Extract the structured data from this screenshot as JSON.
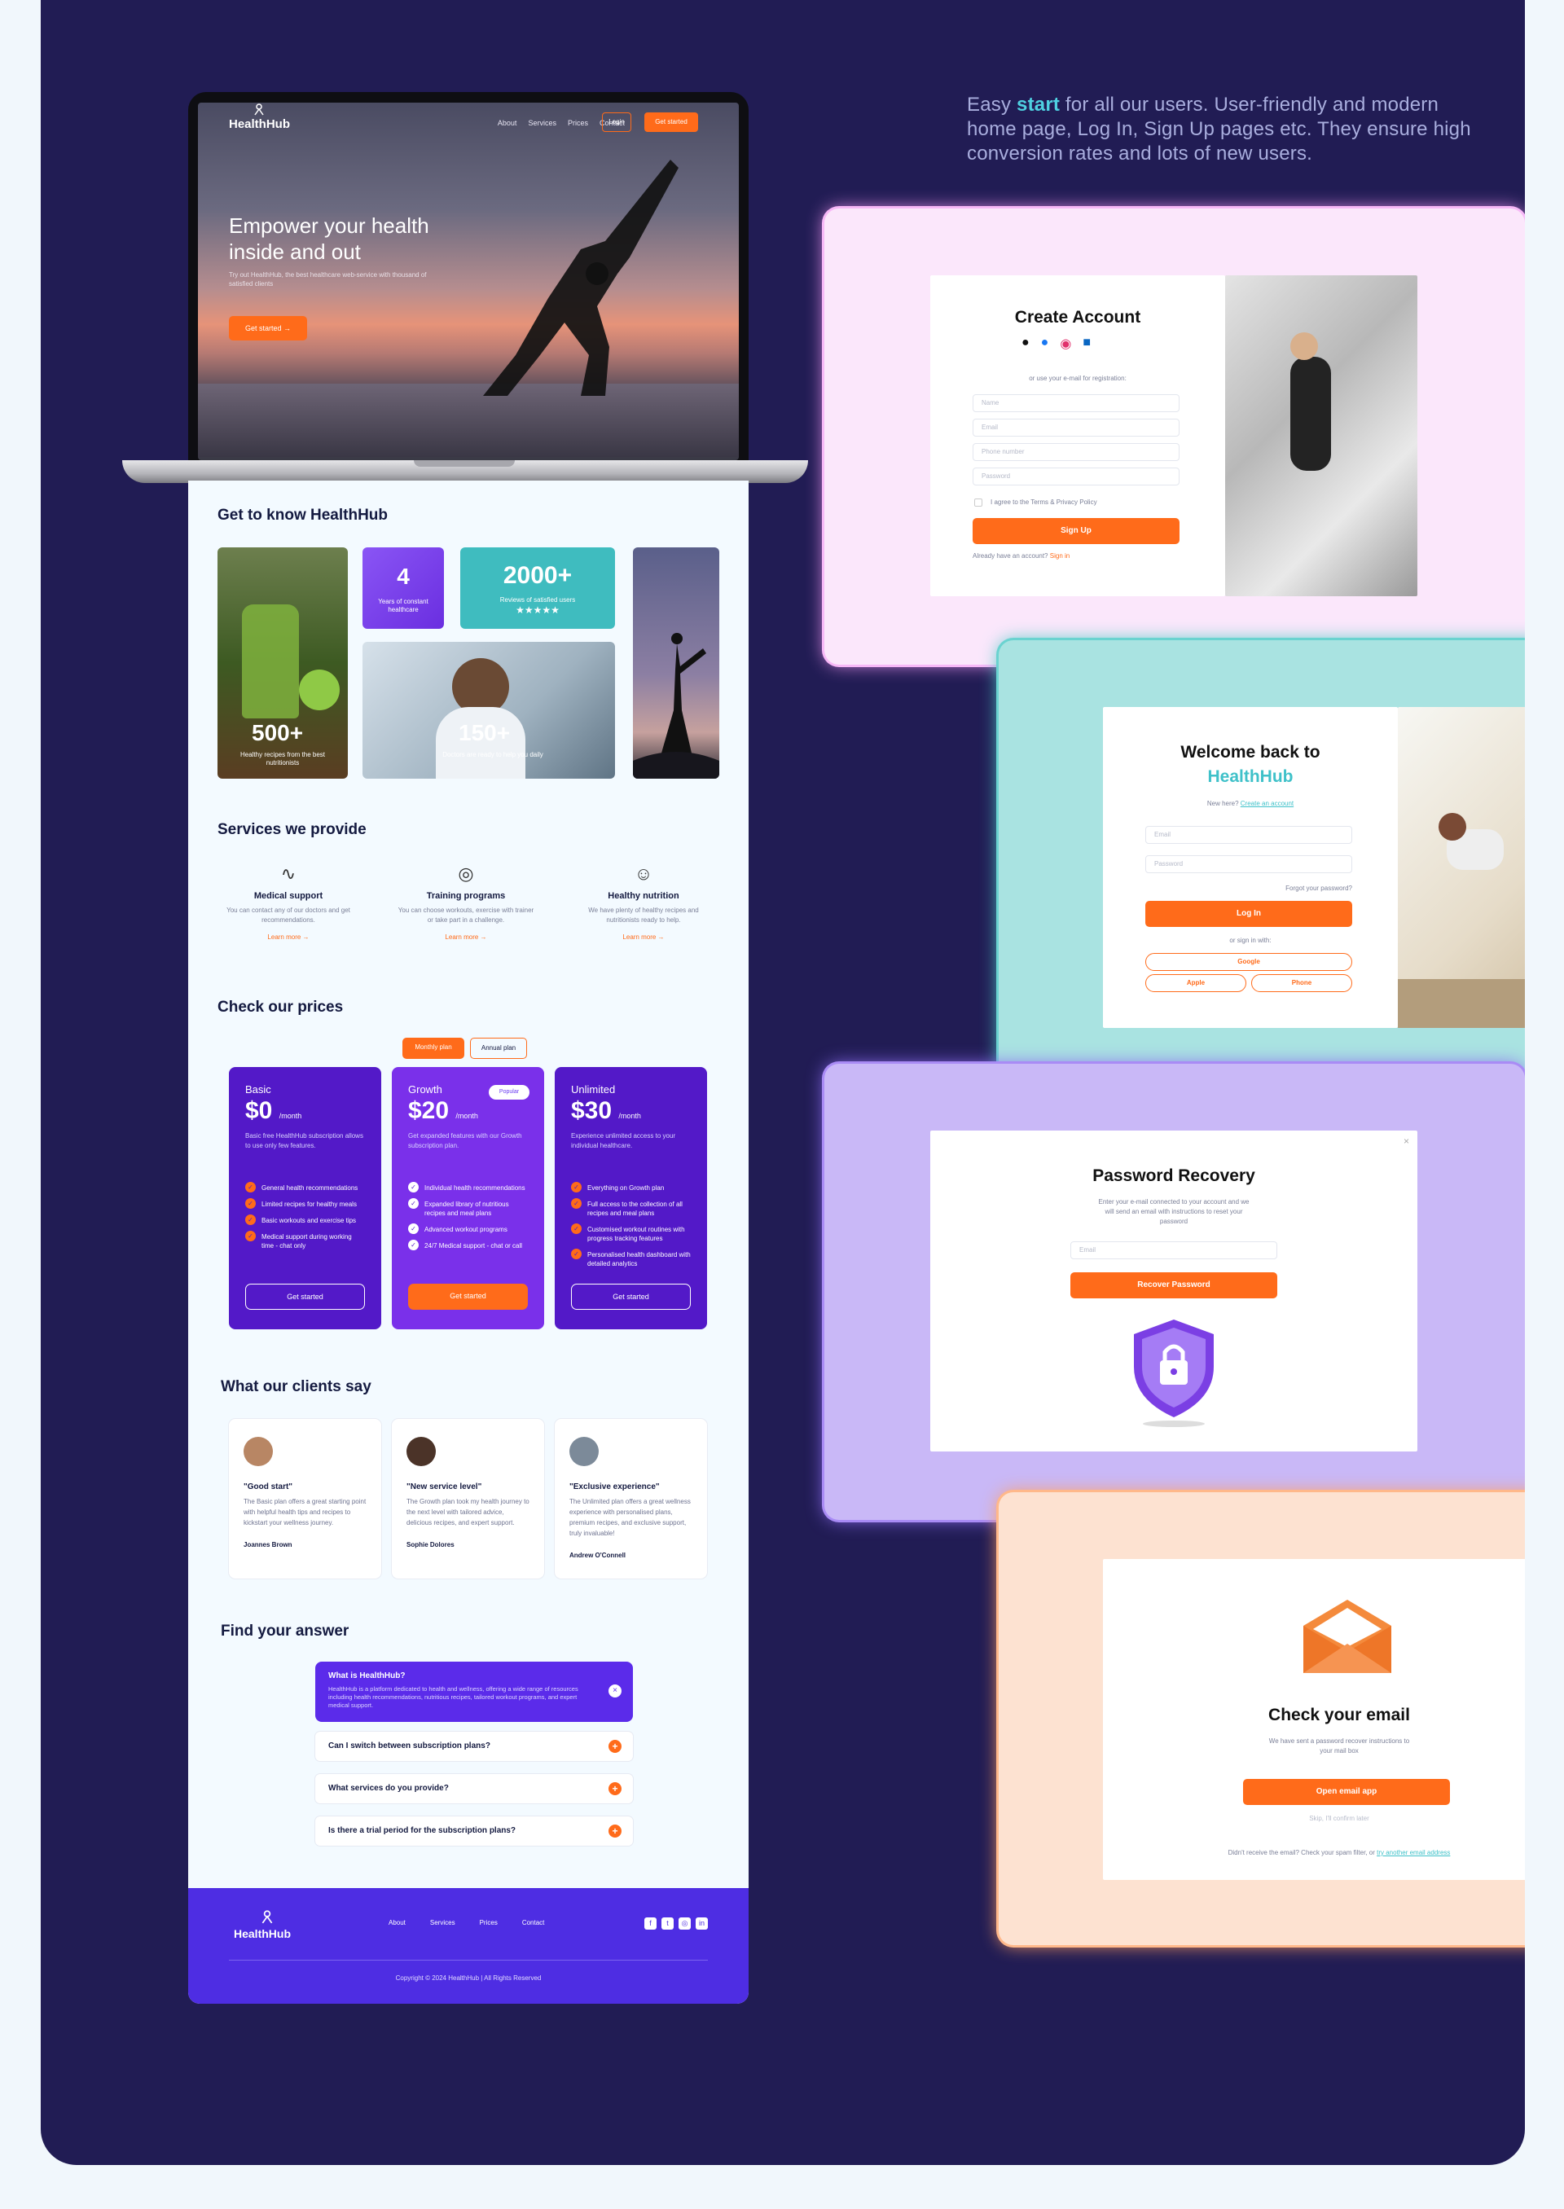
{
  "blurb": {
    "pre": "Easy ",
    "highlight": "start",
    "post": " for all our users. User-friendly and modern home page, Log In, Sign Up pages etc. They ensure high conversion rates and lots of new users."
  },
  "hero": {
    "brand": "HealthHub",
    "nav": [
      "About",
      "Services",
      "Prices",
      "Contact"
    ],
    "login": "Login",
    "get_started": "Get started",
    "title": "Empower your health inside and out",
    "subtitle": "Try out HealthHub, the best healthcare web-service with thousand of satisfied clients",
    "cta": "Get started →"
  },
  "know": {
    "title": "Get to know HealthHub",
    "stat1": {
      "value": "4",
      "caption": "Years of constant healthcare"
    },
    "stat2": {
      "value": "2000+",
      "caption": "Reviews of satisfied users",
      "stars": "★★★★★"
    },
    "stat3": {
      "value": "500+",
      "caption": "Healthy recipes from the best nutritionists"
    },
    "stat4": {
      "value": "150+",
      "caption": "Doctors are ready to help you daily"
    }
  },
  "services": {
    "title": "Services we provide",
    "items": [
      {
        "icon": "∿",
        "name": "Medical support",
        "desc": "You can contact any of our doctors and get recommendations.",
        "link": "Learn more →"
      },
      {
        "icon": "◎",
        "name": "Training programs",
        "desc": "You can choose workouts, exercise with trainer or take part in a challenge.",
        "link": "Learn more →"
      },
      {
        "icon": "☺",
        "name": "Healthy nutrition",
        "desc": "We have plenty of healthy recipes and nutritionists ready to help.",
        "link": "Learn more →"
      }
    ]
  },
  "prices": {
    "title": "Check our prices",
    "monthly": "Monthly plan",
    "annual": "Annual plan",
    "plans": [
      {
        "name": "Basic",
        "price": "$0",
        "per": "/month",
        "desc": "Basic free HealthHub subscription allows to use only few features.",
        "features": [
          "General health recommendations",
          "Limited recipes for healthy meals",
          "Basic workouts and exercise tips",
          "Medical support during working time - chat only"
        ],
        "button": "Get started"
      },
      {
        "name": "Growth",
        "badge": "Popular",
        "price": "$20",
        "per": "/month",
        "desc": "Get expanded features with our Growth subscription plan.",
        "features": [
          "Individual health recommendations",
          "Expanded library of nutritious recipes and meal plans",
          "Advanced workout programs",
          "24/7 Medical support - chat or call"
        ],
        "button": "Get started"
      },
      {
        "name": "Unlimited",
        "price": "$30",
        "per": "/month",
        "desc": "Experience unlimited access to your individual healthcare.",
        "features": [
          "Everything on Growth plan",
          "Full access to the collection of all recipes and meal plans",
          "Customised workout routines with progress tracking features",
          "Personalised health dashboard with detailed analytics"
        ],
        "button": "Get started"
      }
    ]
  },
  "clients": {
    "title": "What our clients say",
    "items": [
      {
        "quote": "\"Good start\"",
        "text": "The Basic plan offers a great starting point with helpful health tips and recipes to kickstart your wellness journey.",
        "name": "Joannes Brown"
      },
      {
        "quote": "\"New service level\"",
        "text": "The Growth plan took my health journey to the next level with tailored advice, delicious recipes, and expert support.",
        "name": "Sophie Dolores"
      },
      {
        "quote": "\"Exclusive experience\"",
        "text": "The Unlimited plan offers a great wellness experience with personalised plans, premium recipes, and exclusive support, truly invaluable!",
        "name": "Andrew O'Connell"
      }
    ]
  },
  "faq": {
    "title": "Find your answer",
    "open_q": "What is HealthHub?",
    "open_a": "HealthHub is a platform dedicated to health and wellness, offering a wide range of resources including health recommendations, nutritious recipes, tailored workout programs, and expert medical support.",
    "items": [
      "Can I switch between subscription plans?",
      "What services do you provide?",
      "Is there a trial period for the subscription plans?"
    ]
  },
  "footer": {
    "brand": "HealthHub",
    "links": [
      "About",
      "Services",
      "Prices",
      "Contact"
    ],
    "copyright": "Copyright © 2024 HealthHub | All Rights Reserved"
  },
  "signup": {
    "title": "Create Account",
    "or": "or use your e-mail for registration:",
    "fields": [
      "Name",
      "Email",
      "Phone number",
      "Password"
    ],
    "agree": "I agree to the Terms & Privacy Policy",
    "button": "Sign Up",
    "have": "Already have an account?",
    "signin": "Sign in"
  },
  "login": {
    "title1": "Welcome back to",
    "title2": "HealthHub",
    "new_here": "New here?",
    "create": "Create an account",
    "fields": [
      "Email",
      "Password"
    ],
    "forgot": "Forgot your password?",
    "button": "Log In",
    "or": "or sign in with:",
    "google": "Google",
    "apple": "Apple",
    "phone": "Phone"
  },
  "recovery": {
    "title": "Password Recovery",
    "desc": "Enter your e-mail connected to your account and we will send an email with instructions to reset your password",
    "field": "Email",
    "button": "Recover Password"
  },
  "check": {
    "title": "Check your email",
    "desc": "We have sent a password recover instructions to your mail box",
    "button": "Open email app",
    "skip": "Skip, I'll confirm later",
    "didnt": "Didn't receive the email? Check your spam filter, or",
    "other": "try another email address"
  },
  "colors": {
    "navy": "#211c54",
    "orange": "#ff6b1a",
    "purple": "#5b21cf",
    "teal": "#3fc1c9"
  }
}
